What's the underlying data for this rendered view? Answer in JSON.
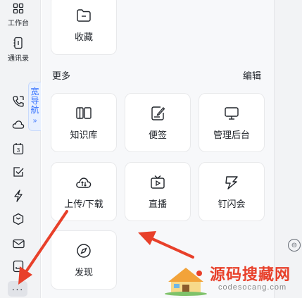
{
  "sidebar": {
    "workbench_label": "工作台",
    "contacts_label": "通讯录",
    "wide_nav_label": [
      "宽",
      "导",
      "航"
    ],
    "wide_nav_chevron": "»",
    "more_label": "···",
    "icons": [
      "phone-icon",
      "cloud-icon",
      "calendar-icon",
      "check-icon",
      "lightning-icon",
      "cube-icon",
      "mail-icon",
      "doc-icon"
    ]
  },
  "panel": {
    "favorites_label": "收藏",
    "section_title": "更多",
    "edit_label": "编辑",
    "apps": [
      {
        "label": "知识库",
        "icon": "book-icon"
      },
      {
        "label": "便签",
        "icon": "note-icon"
      },
      {
        "label": "管理后台",
        "icon": "monitor-icon"
      },
      {
        "label": "上传/下载",
        "icon": "cloud-transfer-icon"
      },
      {
        "label": "直播",
        "icon": "tv-icon"
      },
      {
        "label": "钉闪会",
        "icon": "flash-meeting-icon"
      },
      {
        "label": "发现",
        "icon": "compass-icon"
      }
    ]
  },
  "watermark": {
    "title": "源码搜藏网",
    "subtitle": "codesocang.com"
  },
  "colors": {
    "accent": "#3370ff",
    "arrow": "#e8402a",
    "panel_bg": "#f7f8fa",
    "sidebar_bg": "#f2f3f5"
  }
}
